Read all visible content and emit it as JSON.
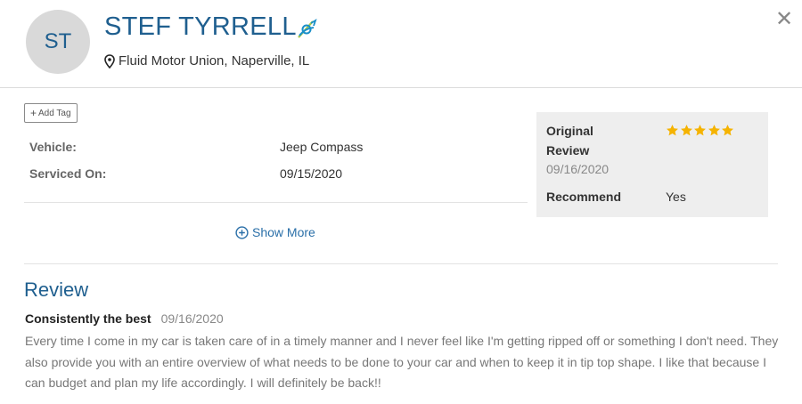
{
  "header": {
    "initials": "ST",
    "name": "STEF TYRRELL",
    "location": "Fluid Motor Union, Naperville, IL",
    "close_symbol": "✕",
    "badge_icon": "verified-badge-icon",
    "location_icon": "map-pin-icon"
  },
  "details": {
    "add_tag_label": "Add Tag",
    "vehicle_label": "Vehicle:",
    "vehicle_value": "Jeep Compass",
    "serviced_label": "Serviced On:",
    "serviced_value": "09/15/2020",
    "show_more_label": "Show More"
  },
  "summary": {
    "original_review_label": "Original Review",
    "rating": 5,
    "rating_max": 5,
    "date": "09/16/2020",
    "recommend_label": "Recommend",
    "recommend_value": "Yes"
  },
  "review": {
    "section_title": "Review",
    "title": "Consistently the best",
    "date": "09/16/2020",
    "body": "Every time I come in my car is taken care of in a timely manner and I never feel like I'm getting ripped off or something I don't need. They also provide you with an entire overview of what needs to be done to your car and when to keep it in tip top shape. I like that because I can budget and plan my life accordingly. I will definitely be back!!"
  },
  "colors": {
    "brand": "#1f5f8f",
    "link": "#2a6fa8",
    "star": "#f5b301",
    "badge": "#1a8fc9",
    "badge_accent": "#a6c94a"
  }
}
